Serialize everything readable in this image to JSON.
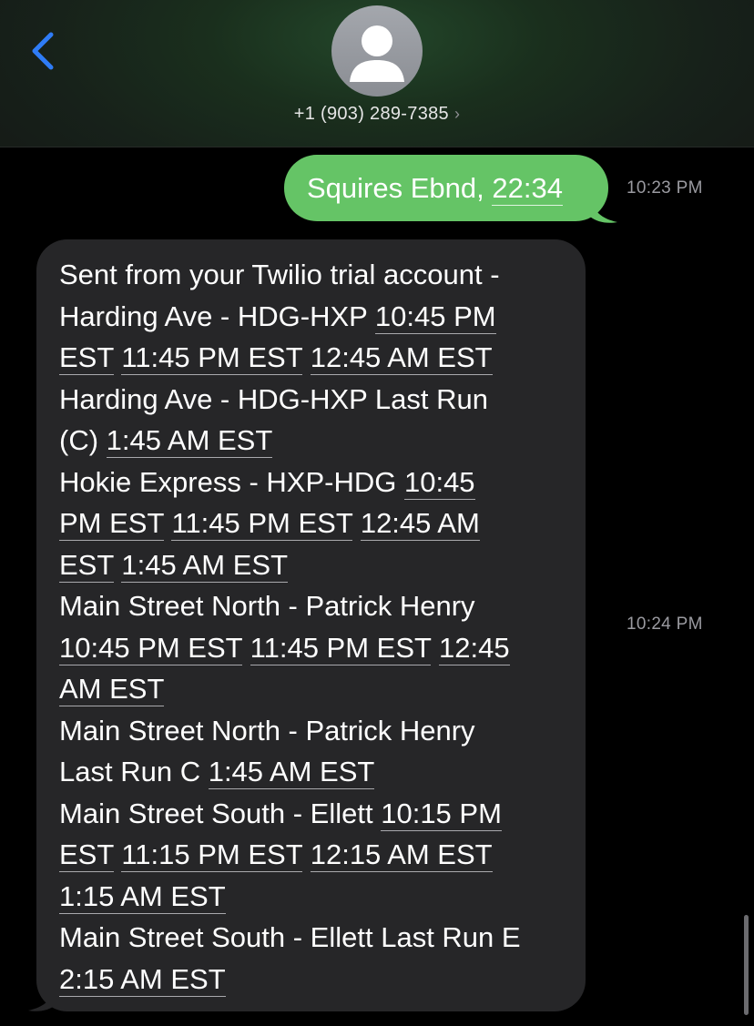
{
  "header": {
    "contact_number": "+1 (903) 289-7385",
    "chevron": "›"
  },
  "colors": {
    "outgoing_bubble": "#65c466",
    "incoming_bubble": "#262628",
    "accent_blue": "#2f7cf6"
  },
  "icons": {
    "back": "chevron-left-icon",
    "avatar": "person-silhouette-icon",
    "contact_chevron": "chevron-right-icon"
  },
  "messages": [
    {
      "direction": "outgoing",
      "time": "10:23 PM",
      "text_prefix": "Squires Ebnd, ",
      "link_time": "22:34"
    },
    {
      "direction": "incoming",
      "time": "10:24 PM",
      "lines": [
        {
          "text": "Sent from your Twilio trial account -"
        },
        {
          "t1": "Harding Ave - HDG-HXP ",
          "l1": "10:45 PM"
        },
        {
          "l1": "EST",
          "t2": " ",
          "l2": "11:45 PM EST",
          "t3": " ",
          "l3": "12:45 AM EST"
        },
        {
          "text": "Harding Ave - HDG-HXP Last Run"
        },
        {
          "t1": "(C) ",
          "l1": "1:45 AM EST"
        },
        {
          "t1": "Hokie Express - HXP-HDG ",
          "l1": "10:45"
        },
        {
          "l1": "PM EST",
          "t2": " ",
          "l2": "11:45 PM EST",
          "t3": " ",
          "l3": "12:45 AM"
        },
        {
          "l1": "EST",
          "t2": " ",
          "l2": "1:45 AM EST"
        },
        {
          "text": "Main Street North - Patrick Henry"
        },
        {
          "l1": "10:45 PM EST",
          "t2": " ",
          "l2": "11:45 PM EST",
          "t3": " ",
          "l3": "12:45"
        },
        {
          "l1": "AM EST"
        },
        {
          "text": "Main Street North - Patrick Henry"
        },
        {
          "t1": "Last Run C ",
          "l1": "1:45 AM EST"
        },
        {
          "t1": "Main Street South - Ellett ",
          "l1": "10:15 PM"
        },
        {
          "l1": "EST",
          "t2": " ",
          "l2": "11:15 PM EST",
          "t3": " ",
          "l3": "12:15 AM EST"
        },
        {
          "l1": "1:15 AM EST"
        },
        {
          "text": "Main Street South - Ellett Last Run E"
        },
        {
          "l1": "2:15 AM EST"
        }
      ]
    }
  ]
}
